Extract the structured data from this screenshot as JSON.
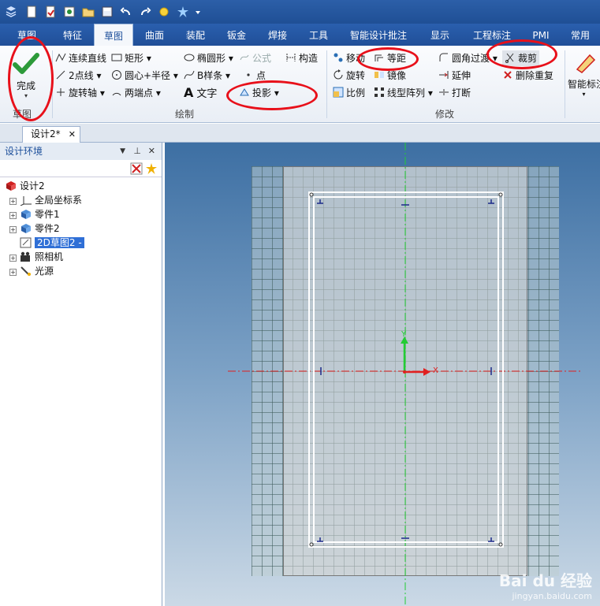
{
  "quick_access": {
    "icons": [
      "app-menu-icon",
      "new-icon",
      "open-icon",
      "import-icon",
      "folder-icon",
      "save-icon",
      "undo-icon",
      "redo-icon",
      "light-icon",
      "sparkle-icon",
      "dropdown-icon"
    ]
  },
  "tabs": [
    "草图",
    "特征",
    "草图",
    "曲面",
    "装配",
    "钣金",
    "焊接",
    "工具",
    "智能设计批注",
    "显示",
    "工程标注",
    "PMI",
    "常用"
  ],
  "active_tab_index": 2,
  "ribbon": {
    "finish": {
      "label": "完成",
      "group": "草图"
    },
    "draw": {
      "group": "绘制",
      "items": [
        {
          "label": "连续直线",
          "icon": "polyline-icon"
        },
        {
          "label": "矩形",
          "icon": "rectangle-icon",
          "dropdown": true
        },
        {
          "label": "2点线",
          "icon": "two-point-line-icon",
          "dropdown": true
        },
        {
          "label": "圆心+半径",
          "icon": "circle-icon",
          "dropdown": true
        },
        {
          "label": "旋转轴",
          "icon": "rotation-axis-icon",
          "dropdown": true
        },
        {
          "label": "两端点",
          "icon": "arc-icon",
          "dropdown": true
        },
        {
          "label": "椭圆形",
          "icon": "ellipse-icon",
          "dropdown": true
        },
        {
          "label": "公式",
          "icon": "formula-icon",
          "disabled": true
        },
        {
          "label": "B样条",
          "icon": "spline-icon",
          "dropdown": true
        },
        {
          "label": "点",
          "icon": "point-icon"
        },
        {
          "label": "文字",
          "icon": "text-icon"
        },
        {
          "label": "投影",
          "icon": "projection-icon",
          "dropdown": true
        },
        {
          "label": "构造",
          "icon": "construction-icon"
        }
      ]
    },
    "modify": {
      "group": "修改",
      "items": [
        {
          "label": "移动",
          "icon": "move-icon"
        },
        {
          "label": "等距",
          "icon": "offset-icon"
        },
        {
          "label": "圆角过渡",
          "icon": "fillet-icon",
          "dropdown": true
        },
        {
          "label": "裁剪",
          "icon": "trim-icon"
        },
        {
          "label": "旋转",
          "icon": "rotate-icon"
        },
        {
          "label": "镜像",
          "icon": "mirror-icon"
        },
        {
          "label": "延伸",
          "icon": "extend-icon"
        },
        {
          "label": "删除重复",
          "icon": "delete-duplicates-icon"
        },
        {
          "label": "比例",
          "icon": "scale-icon"
        },
        {
          "label": "线型阵列",
          "icon": "linear-pattern-icon",
          "dropdown": true
        },
        {
          "label": "打断",
          "icon": "break-icon"
        }
      ]
    },
    "smart": {
      "label": "智能标注"
    }
  },
  "document_tab": {
    "label": "设计2*"
  },
  "panel": {
    "title": "设计环境",
    "tree": [
      {
        "label": "设计2",
        "icon": "design-root-icon",
        "level": 0
      },
      {
        "label": "全局坐标系",
        "icon": "coordinate-system-icon",
        "level": 1
      },
      {
        "label": "零件1",
        "icon": "part-icon",
        "level": 1
      },
      {
        "label": "零件2",
        "icon": "part-icon",
        "level": 1
      },
      {
        "label": "2D草图2 -",
        "icon": "sketch-icon",
        "level": 1,
        "selected": true
      },
      {
        "label": "照相机",
        "icon": "camera-icon",
        "level": 1
      },
      {
        "label": "光源",
        "icon": "light-source-icon",
        "level": 1
      }
    ]
  },
  "viewport": {
    "axis_labels": {
      "x": "X",
      "y": "Y"
    }
  },
  "watermark": {
    "brand": "Bai du 经验",
    "url": "jingyan.baidu.com"
  },
  "colors": {
    "annotation": "#e8101a",
    "ribbon_tab": "#2a5fae",
    "selection": "#2f6fd6"
  }
}
